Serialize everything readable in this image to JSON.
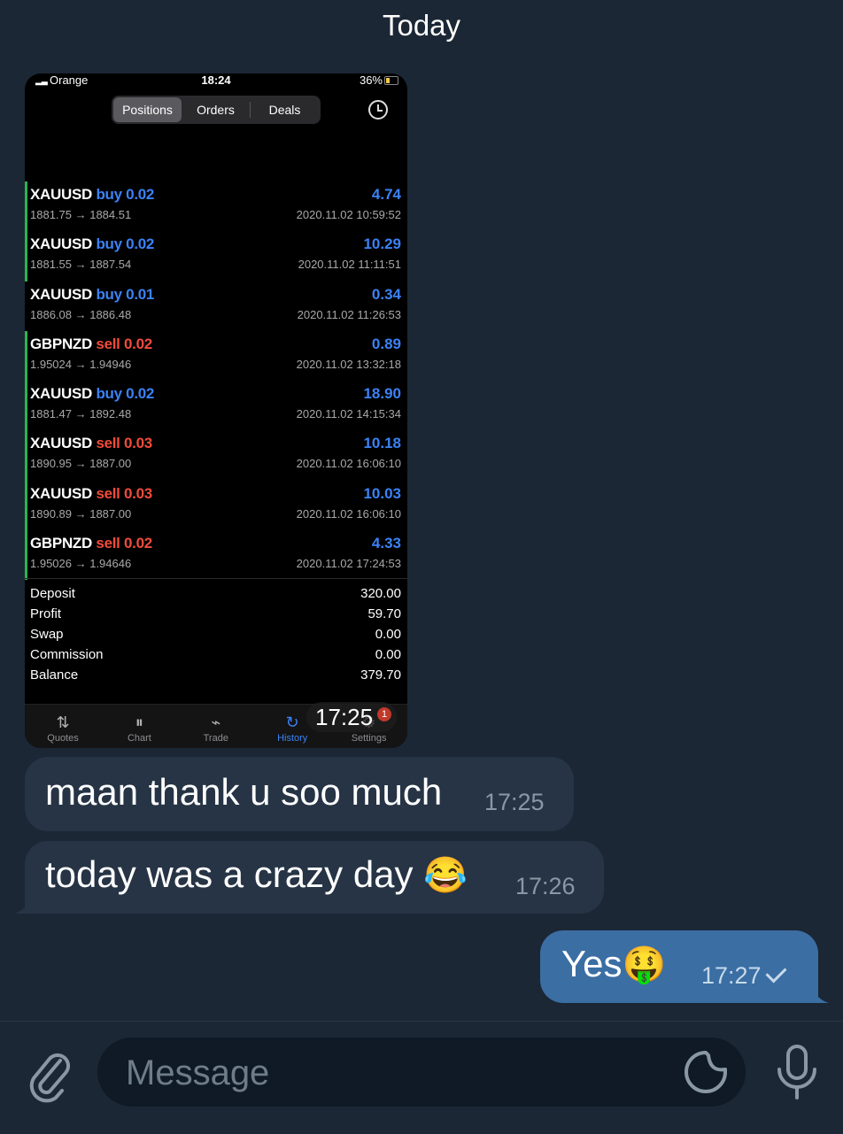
{
  "header": {
    "day": "Today"
  },
  "screenshot": {
    "status": {
      "carrier": "Orange",
      "time": "18:24",
      "battery": "36%"
    },
    "segments": [
      {
        "label": "Positions",
        "active": true
      },
      {
        "label": "Orders",
        "active": false
      },
      {
        "label": "Deals",
        "active": false
      }
    ],
    "trades": [
      {
        "symbol": "XAUUSD",
        "side": "buy 0.02",
        "dir": "buy",
        "prices": "1881.75 → 1884.51",
        "profit": "4.74",
        "date": "2020.11.02 10:59:52",
        "bar": true
      },
      {
        "symbol": "XAUUSD",
        "side": "buy 0.02",
        "dir": "buy",
        "prices": "1881.55 → 1887.54",
        "profit": "10.29",
        "date": "2020.11.02 11:11:51",
        "bar": true
      },
      {
        "symbol": "XAUUSD",
        "side": "buy 0.01",
        "dir": "buy",
        "prices": "1886.08 → 1886.48",
        "profit": "0.34",
        "date": "2020.11.02 11:26:53",
        "bar": false
      },
      {
        "symbol": "GBPNZD",
        "side": "sell 0.02",
        "dir": "sell",
        "prices": "1.95024 → 1.94946",
        "profit": "0.89",
        "date": "2020.11.02 13:32:18",
        "bar": true
      },
      {
        "symbol": "XAUUSD",
        "side": "buy 0.02",
        "dir": "buy",
        "prices": "1881.47 → 1892.48",
        "profit": "18.90",
        "date": "2020.11.02 14:15:34",
        "bar": true
      },
      {
        "symbol": "XAUUSD",
        "side": "sell 0.03",
        "dir": "sell",
        "prices": "1890.95 → 1887.00",
        "profit": "10.18",
        "date": "2020.11.02 16:06:10",
        "bar": true
      },
      {
        "symbol": "XAUUSD",
        "side": "sell 0.03",
        "dir": "sell",
        "prices": "1890.89 → 1887.00",
        "profit": "10.03",
        "date": "2020.11.02 16:06:10",
        "bar": true
      },
      {
        "symbol": "GBPNZD",
        "side": "sell 0.02",
        "dir": "sell",
        "prices": "1.95026 → 1.94646",
        "profit": "4.33",
        "date": "2020.11.02 17:24:53",
        "bar": true
      }
    ],
    "summary": [
      {
        "label": "Deposit",
        "value": "320.00"
      },
      {
        "label": "Profit",
        "value": "59.70"
      },
      {
        "label": "Swap",
        "value": "0.00"
      },
      {
        "label": "Commission",
        "value": "0.00"
      },
      {
        "label": "Balance",
        "value": "379.70"
      }
    ],
    "tabs": [
      {
        "label": "Quotes",
        "icon": "quotes-icon",
        "glyph": "⇅",
        "active": false
      },
      {
        "label": "Chart",
        "icon": "candlestick-icon",
        "glyph": "⏸",
        "active": false
      },
      {
        "label": "Trade",
        "icon": "trade-chart-icon",
        "glyph": "⌁",
        "active": false
      },
      {
        "label": "History",
        "icon": "history-icon",
        "glyph": "↻",
        "active": true
      },
      {
        "label": "Settings",
        "icon": "gear-icon",
        "glyph": "⚙",
        "active": false
      }
    ],
    "badge_count": "1",
    "sent_time": "17:25"
  },
  "messages": [
    {
      "text": "maan thank u soo much",
      "time": "17:25"
    },
    {
      "text": "today was a crazy day",
      "emoji": "😂",
      "time": "17:26"
    },
    {
      "text": "Yes",
      "emoji": "🤑",
      "time": "17:27"
    }
  ],
  "input": {
    "placeholder": "Message"
  },
  "colors": {
    "background": "#1b2735",
    "incoming": "#263445",
    "outgoing": "#3b6ea3",
    "buy": "#3b82f6",
    "sell": "#ef4c3c"
  }
}
